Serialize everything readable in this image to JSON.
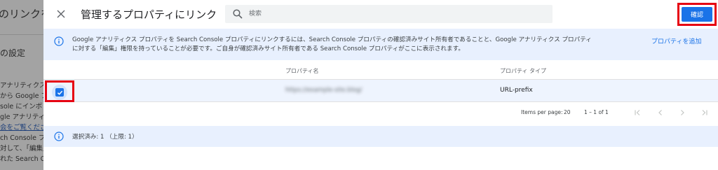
{
  "background_page": {
    "title": "のリンクを",
    "settings_label": "の設定",
    "lines": [
      "アナリティクス プ",
      "から Google ア",
      "sole にインポ",
      "gle アナリティ",
      "会をご覧くださ",
      "ch Console プ",
      "対して、「編集」",
      "れた Search Co"
    ]
  },
  "dialog": {
    "title": "管理するプロパティにリンク",
    "search": {
      "placeholder": "検索",
      "value": ""
    },
    "confirm_label": "確認",
    "icons": {
      "close": "close-icon",
      "search": "search-icon",
      "info": "info-icon",
      "check": "check-icon"
    }
  },
  "info_banner": {
    "line1": "Google アナリティクス プロパティを Search Console プロパティにリンクするには、Search Console プロパティの確認済みサイト所有者であることと、Google アナリティクス プロパティ",
    "line2": "に対する「編集」権限を持っていることが必要です。ご自身が確認済みサイト所有者である Search Console プロパティがここに表示されます。",
    "action_label": "プロパティを追加"
  },
  "table": {
    "columns": [
      "プロパティ名",
      "プロパティ タイプ"
    ],
    "rows": [
      {
        "checked": true,
        "name": "https://example-site.blog/",
        "type": "URL-prefix"
      }
    ]
  },
  "paginator": {
    "items_per_page_label": "Items per page:",
    "items_per_page_value": "20",
    "range_label": "1 – 1 of 1"
  },
  "selection": {
    "text": "選択済み: 1 （上限: 1）"
  },
  "colors": {
    "accent": "#1a73e8",
    "banner_bg": "#e8f0fe",
    "highlight": "#e60012"
  }
}
